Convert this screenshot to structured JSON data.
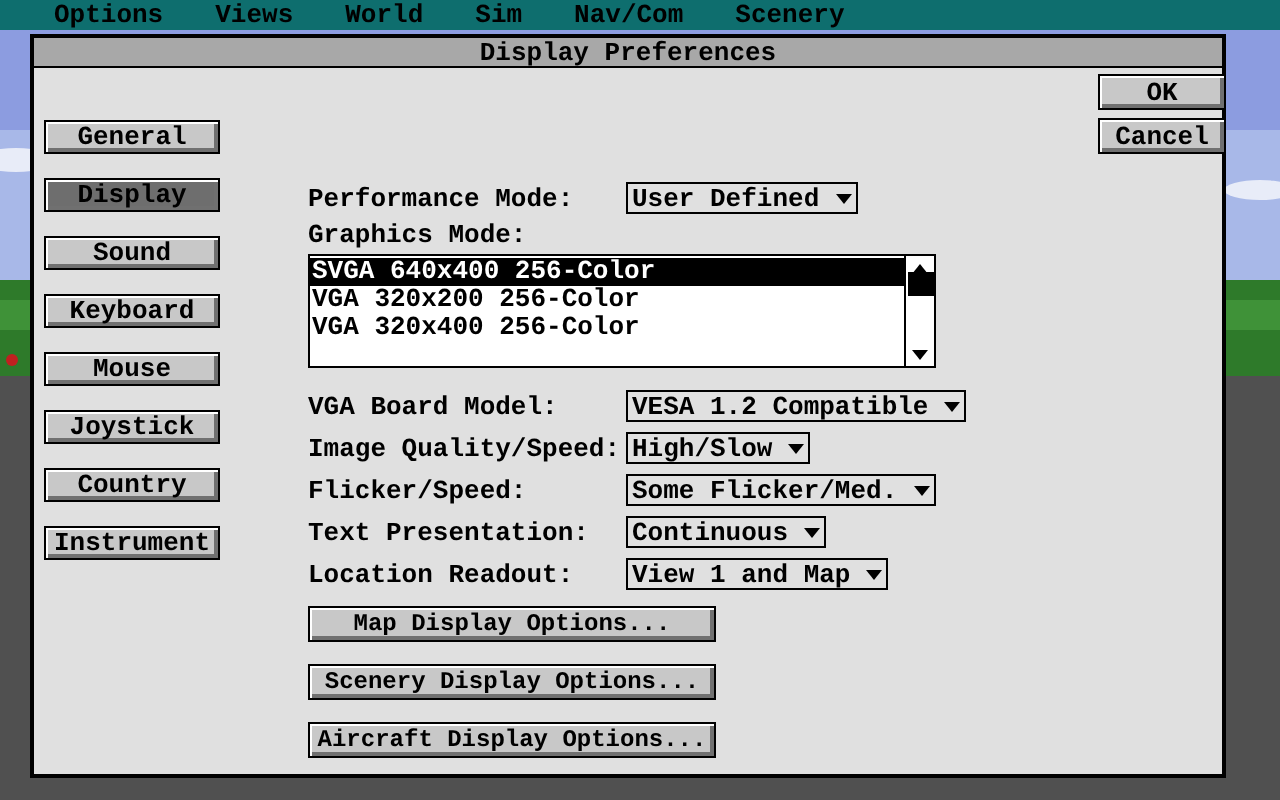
{
  "menu_bar": [
    "Options",
    "Views",
    "World",
    "Sim",
    "Nav/Com",
    "Scenery"
  ],
  "dialog": {
    "title": "Display Preferences",
    "nav": [
      {
        "label": "General",
        "selected": false
      },
      {
        "label": "Display",
        "selected": true
      },
      {
        "label": "Sound",
        "selected": false
      },
      {
        "label": "Keyboard",
        "selected": false
      },
      {
        "label": "Mouse",
        "selected": false
      },
      {
        "label": "Joystick",
        "selected": false
      },
      {
        "label": "Country",
        "selected": false
      },
      {
        "label": "Instrument",
        "selected": false
      }
    ],
    "buttons": [
      "OK",
      "Cancel"
    ],
    "performance_mode": {
      "label": "Performance Mode:",
      "value": "User Defined"
    },
    "graphics_mode": {
      "label": "Graphics Mode:",
      "items": [
        {
          "label": "SVGA 640x400 256-Color",
          "selected": true
        },
        {
          "label": "VGA 320x200 256-Color",
          "selected": false
        },
        {
          "label": "VGA 320x400 256-Color",
          "selected": false
        }
      ]
    },
    "settings": [
      {
        "label": "VGA Board Model:",
        "value": "VESA 1.2 Compatible"
      },
      {
        "label": "Image Quality/Speed:",
        "value": "High/Slow"
      },
      {
        "label": "Flicker/Speed:",
        "value": "Some Flicker/Med."
      },
      {
        "label": "Text Presentation:",
        "value": "Continuous"
      },
      {
        "label": "Location Readout:",
        "value": "View 1 and Map"
      }
    ],
    "option_buttons": [
      "Map Display Options...",
      "Scenery Display Options...",
      "Aircraft Display Options..."
    ]
  }
}
